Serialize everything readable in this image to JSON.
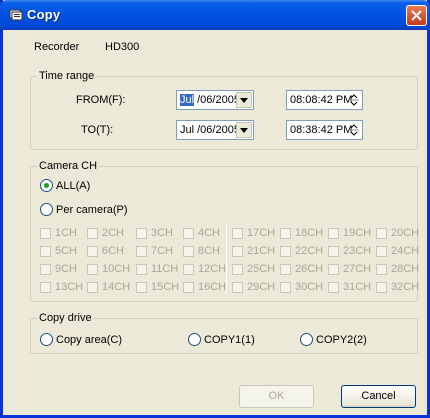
{
  "window": {
    "title": "Copy"
  },
  "recorder": {
    "label": "Recorder",
    "value": "HD300"
  },
  "time_range": {
    "title": "Time range",
    "from_label": "FROM(F):",
    "from_date_month": "Jul",
    "from_date_rest": " /06/2005",
    "from_time": "08:08:42 PM",
    "to_label": "TO(T):",
    "to_date": "Jul /06/2005",
    "to_time": "08:38:42 PM"
  },
  "camera": {
    "title": "Camera CH",
    "all_label": "ALL(A)",
    "per_camera_label": "Per camera(P)",
    "channels": [
      [
        "1CH",
        "2CH",
        "3CH",
        "4CH",
        "17CH",
        "18CH",
        "19CH",
        "20CH"
      ],
      [
        "5CH",
        "6CH",
        "7CH",
        "8CH",
        "21CH",
        "22CH",
        "23CH",
        "24CH"
      ],
      [
        "9CH",
        "10CH",
        "11CH",
        "12CH",
        "25CH",
        "26CH",
        "27CH",
        "28CH"
      ],
      [
        "13CH",
        "14CH",
        "15CH",
        "16CH",
        "29CH",
        "30CH",
        "31CH",
        "32CH"
      ]
    ]
  },
  "copy_drive": {
    "title": "Copy drive",
    "options": [
      "Copy area(C)",
      "COPY1(1)",
      "COPY2(2)"
    ]
  },
  "buttons": {
    "ok": "OK",
    "cancel": "Cancel"
  }
}
